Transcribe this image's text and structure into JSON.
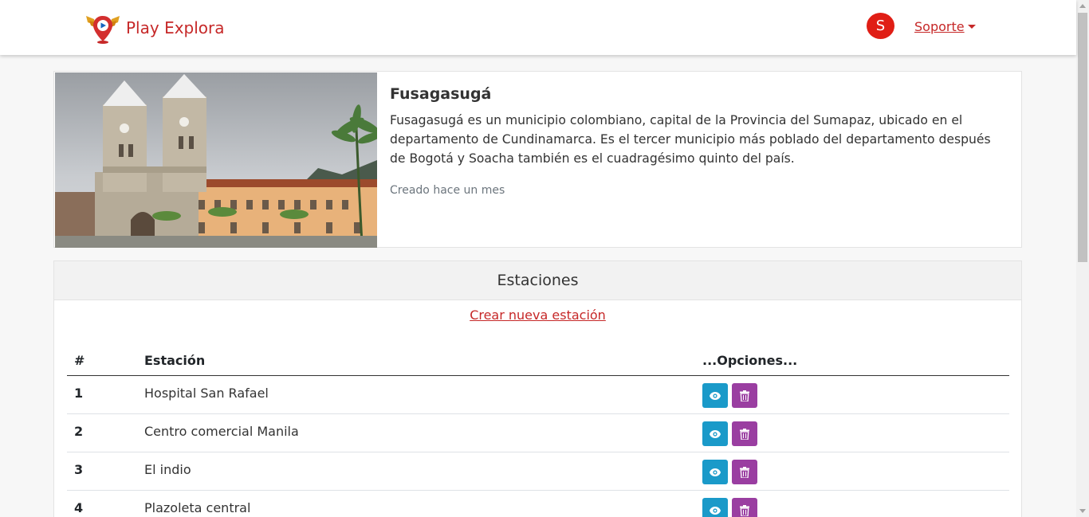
{
  "header": {
    "brand": "Play Explora",
    "avatar_initial": "S",
    "support_label": "Soporte"
  },
  "city": {
    "name": "Fusagasugá",
    "description": "Fusagasugá es un municipio colombiano, capital de la Provincia del Sumapaz, ubicado en el departamento de Cundinamarca. Es el tercer municipio más poblado del departamento después de Bogotá y Soacha también es el cuadragésimo quinto del país.",
    "created": "Creado hace un mes"
  },
  "stations": {
    "title": "Estaciones",
    "create_link": "Crear nueva estación",
    "columns": {
      "num": "#",
      "name": "Estación",
      "options": "...Opciones..."
    },
    "rows": [
      {
        "num": "1",
        "name": "Hospital San Rafael"
      },
      {
        "num": "2",
        "name": "Centro comercial Manila"
      },
      {
        "num": "3",
        "name": "El indio"
      },
      {
        "num": "4",
        "name": "Plazoleta central"
      }
    ]
  },
  "colors": {
    "brand_red": "#c62828",
    "avatar_red": "#e01e15",
    "view_button": "#1a9ac9",
    "delete_button": "#9a3ea1"
  },
  "icons": {
    "logo": "location-pin-wings-logo",
    "view": "eye-icon",
    "delete": "trash-icon",
    "dropdown": "caret-down-icon"
  }
}
